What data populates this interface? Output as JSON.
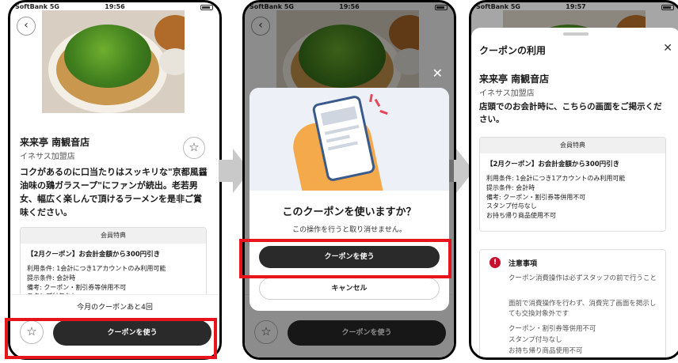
{
  "status": {
    "carrier": "SoftBank 5G",
    "time1": "19:56",
    "time2": "19:56",
    "time3": "19:57"
  },
  "shop": {
    "name": "来来亭 南観音店",
    "branch": "イネサス加盟店",
    "description": "コクがあるのに口当たりはスッキリな\"京都風醤油味の鶏ガラスープ\"にファンが続出。老若男女、幅広く楽しんで頂けるラーメンを是非ご賞味ください。"
  },
  "benefit": {
    "header": "会員特典",
    "title": "【2月クーポン】お会計金額から300円引き",
    "lines": [
      "利用条件: 1会計につき1アカウントのみ利用可能",
      "提示条件: 会計時",
      "備考: クーポン・割引券等併用不可",
      "スタンプ付与なし",
      "お持ち帰り商品使用不可"
    ]
  },
  "bottom": {
    "remaining": "今月のクーポンあと4回",
    "use_label": "クーポンを使う"
  },
  "dialog": {
    "question": "このクーポンを使いますか？",
    "subtext": "この操作を行うと取り消せません。",
    "confirm_label": "クーポンを使う",
    "cancel_label": "キャンセル"
  },
  "sheet": {
    "title": "クーポンの利用",
    "instruction": "店頭でのお会計時に、こちらの画面をご掲示ください。",
    "notes_title": "注意事項",
    "notes": [
      "クーポン消費操作は必ずスタッフの前で行うこと",
      "面前で消費操作を行わず、消費完了画面を掲示しても交換対象外です",
      "クーポン・割引券等併用不可",
      "スタンプ付与なし",
      "お持ち帰り商品使用不可"
    ]
  },
  "colors": {
    "highlight": "#e8141b",
    "button_dark": "#2a2a2a",
    "arrow": "#c9c9c9",
    "warning": "#c8102e"
  }
}
